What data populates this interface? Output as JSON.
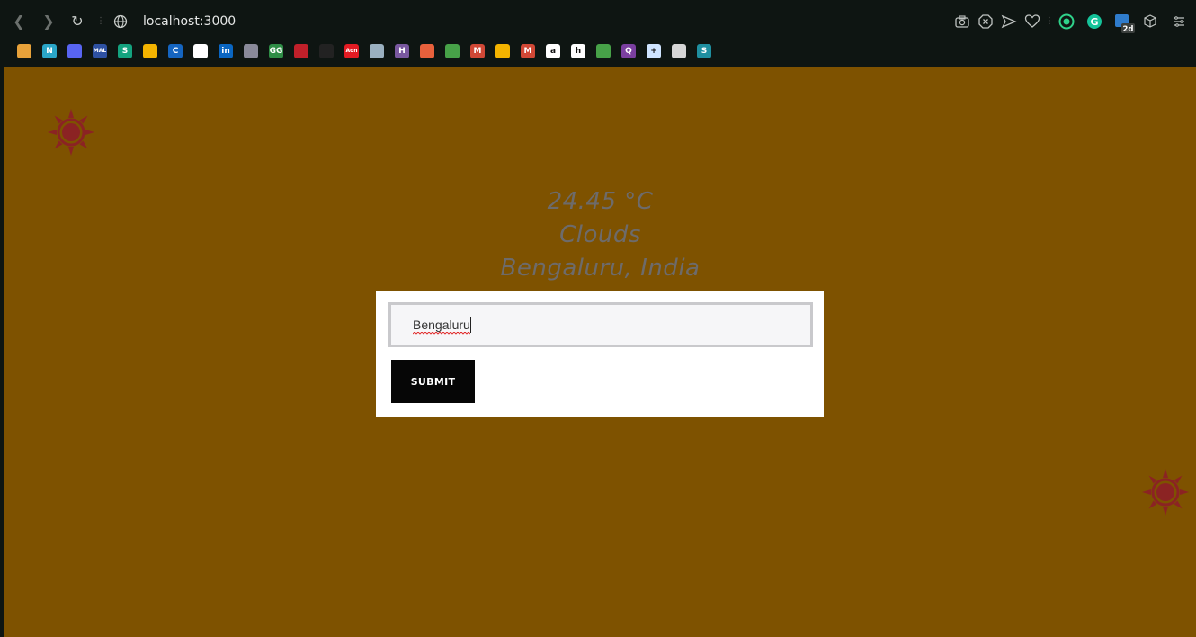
{
  "browser": {
    "url": "localhost:3000",
    "icons": [
      "back-icon",
      "forward-icon",
      "reload-icon",
      "site-info-icon",
      "screenshot-icon",
      "ad-block-icon",
      "send-icon",
      "heart-icon",
      "grammarly-icon",
      "extension-badge-icon",
      "cube-icon",
      "menu-icon"
    ],
    "extension_badge": "2d"
  },
  "bookmarks": [
    {
      "name": "bookmark-store",
      "glyph": "",
      "color": "#e8a23a"
    },
    {
      "name": "bookmark-notion-n",
      "glyph": "N",
      "color": "#2aa6c8"
    },
    {
      "name": "bookmark-discord",
      "glyph": "",
      "color": "#5865f2"
    },
    {
      "name": "bookmark-mal",
      "glyph": "MAL",
      "color": "#2e51a2"
    },
    {
      "name": "bookmark-s-green",
      "glyph": "S",
      "color": "#14a37f"
    },
    {
      "name": "bookmark-drive",
      "glyph": "",
      "color": "#f4b400"
    },
    {
      "name": "bookmark-c-blue",
      "glyph": "C",
      "color": "#1565c0"
    },
    {
      "name": "bookmark-github",
      "glyph": "",
      "color": "#ffffff"
    },
    {
      "name": "bookmark-linkedin",
      "glyph": "in",
      "color": "#0a66c2"
    },
    {
      "name": "bookmark-castle",
      "glyph": "",
      "color": "#8a8a9a"
    },
    {
      "name": "bookmark-geeksforgeeks",
      "glyph": "GG",
      "color": "#2f8d46"
    },
    {
      "name": "bookmark-red-book",
      "glyph": "",
      "color": "#c0202a"
    },
    {
      "name": "bookmark-black-horse",
      "glyph": "",
      "color": "#222222"
    },
    {
      "name": "bookmark-aon",
      "glyph": "Aon",
      "color": "#e31b23"
    },
    {
      "name": "bookmark-mountain",
      "glyph": "",
      "color": "#9ab0c0"
    },
    {
      "name": "bookmark-heroku",
      "glyph": "H",
      "color": "#79589f"
    },
    {
      "name": "bookmark-clock",
      "glyph": "",
      "color": "#e8613c"
    },
    {
      "name": "bookmark-mongodb",
      "glyph": "",
      "color": "#47a248"
    },
    {
      "name": "bookmark-gmail-1",
      "glyph": "M",
      "color": "#d14836"
    },
    {
      "name": "bookmark-drive-2",
      "glyph": "",
      "color": "#f4b400"
    },
    {
      "name": "bookmark-gmail-2",
      "glyph": "M",
      "color": "#d14836"
    },
    {
      "name": "bookmark-amazon",
      "glyph": "a",
      "color": "#ffffff"
    },
    {
      "name": "bookmark-hackerrank",
      "glyph": "h",
      "color": "#ffffff"
    },
    {
      "name": "bookmark-mongodb-2",
      "glyph": "",
      "color": "#47a248"
    },
    {
      "name": "bookmark-purple-q",
      "glyph": "Q",
      "color": "#7b3fa0"
    },
    {
      "name": "bookmark-plus",
      "glyph": "+",
      "color": "#cfe4ff"
    },
    {
      "name": "bookmark-image",
      "glyph": "",
      "color": "#d6d6d6"
    },
    {
      "name": "bookmark-s-teal",
      "glyph": "S",
      "color": "#1f8fa0"
    }
  ],
  "weather": {
    "temperature": "24.45 °C",
    "condition": "Clouds",
    "location": "Bengaluru, India"
  },
  "form": {
    "city_value": "Bengaluru",
    "submit_label": "SUBMIT"
  },
  "colors": {
    "page_background": "#7e5200",
    "weather_text": "#6d6b6b",
    "sun": "#8b2323",
    "button": "#060606"
  }
}
